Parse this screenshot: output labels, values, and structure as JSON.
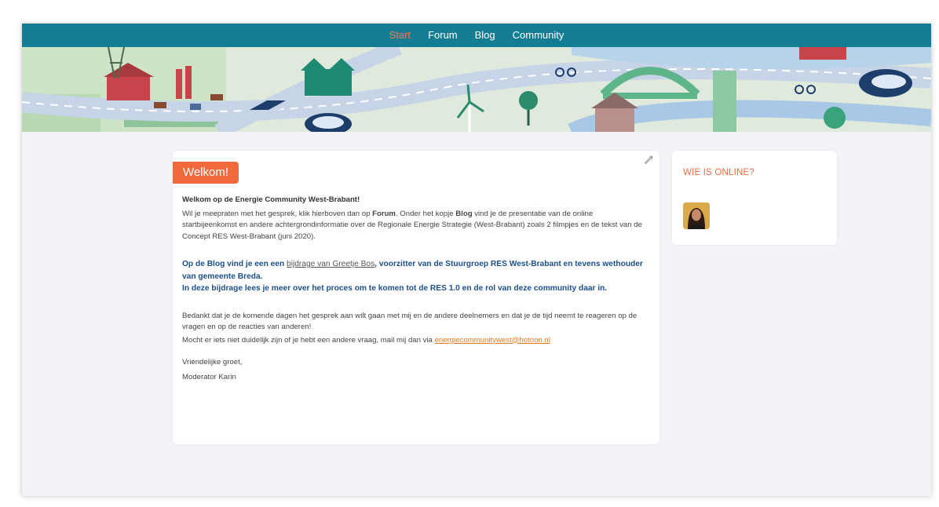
{
  "nav": {
    "items": [
      {
        "label": "Start",
        "active": true
      },
      {
        "label": "Forum",
        "active": false
      },
      {
        "label": "Blog",
        "active": false
      },
      {
        "label": "Community",
        "active": false
      }
    ]
  },
  "colors": {
    "navbar": "#157d93",
    "accent": "#f06a3b",
    "link_blue": "#1d4f8a",
    "mail_link": "#e07a20"
  },
  "welcome": {
    "badge": "Welkom!",
    "heading": "Welkom op de Energie Community West-Brabant!",
    "intro_1": "Wil je meepraten met het gesprek, klik hierboven dan op ",
    "intro_forum": "Forum",
    "intro_2": ". Onder het kopje ",
    "intro_blog": "Blog",
    "intro_3": " vind je de presentatie van de online startbijeenkomst en andere achtergrondinformatie over de Regionale Energie Strategie (West-Brabant) zoals 2 filmpjes en de tekst van de Concept RES West-Brabant (juni 2020).",
    "blog_1": "Op de Blog vind je een een ",
    "blog_link": "bijdrage van Greetje Bos",
    "blog_2": ", voorzitter van de Stuurgroep RES West-Brabant en tevens wethouder van gemeente Breda.",
    "blog_3": "In deze bijdrage lees je meer over het proces om te komen tot de RES 1.0 en de rol van deze community daar in.",
    "thanks": "Bedankt dat je de komende dagen het gesprek aan wilt gaan met mij en de andere deelnemers en dat je de tijd neemt te reageren op de vragen en op de reacties van anderen!",
    "contact_1": "Mocht er iets niet duidelijk zijn of je hebt een andere vraag, mail mij dan via ",
    "contact_email": "energiecommunitywest@hotoon.nl",
    "greeting": "Vriendelijke groet,",
    "signature": "Moderator Karin"
  },
  "online": {
    "title": "WIE IS ONLINE?"
  },
  "icons": {
    "wrench": "wrench-icon",
    "avatar": "user-avatar"
  }
}
